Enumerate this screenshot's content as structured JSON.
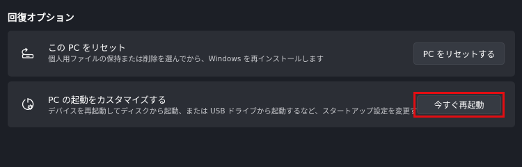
{
  "section": {
    "title": "回復オプション"
  },
  "reset_card": {
    "icon": "reset-pc-icon",
    "title": "この PC をリセット",
    "description": "個人用ファイルの保持または削除を選んでから、Windows を再インストールします",
    "button_label": "PC をリセットする"
  },
  "advanced_card": {
    "icon": "advanced-startup-icon",
    "title": "PC の起動をカスタマイズする",
    "description": "デバイスを再起動してディスクから起動、または USB ドライブから起動するなど、スタートアップ設定を変更する",
    "button_label": "今すぐ再起動"
  },
  "colors": {
    "background": "#1c1f26",
    "card": "#2b2e35",
    "button": "#363a42",
    "highlight": "#e30d12"
  }
}
